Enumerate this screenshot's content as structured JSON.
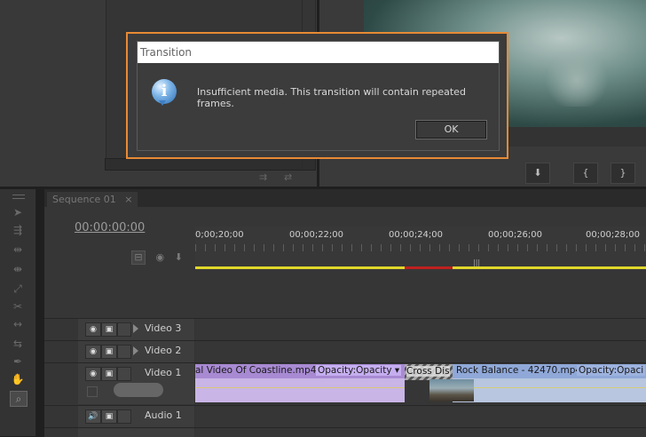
{
  "dialog": {
    "title": "Transition",
    "message": "Insufficient media. This transition will contain repeated frames.",
    "ok_label": "OK",
    "icon": "info-icon"
  },
  "sequence": {
    "tab_label": "Sequence 01",
    "timecode": "00:00:00:00",
    "ruler_labels": [
      "0;00;20;00",
      "00;00;22;00",
      "00;00;24;00",
      "00;00;26;00",
      "00;00;28;00"
    ]
  },
  "tracks": {
    "video3": "Video 3",
    "video2": "Video 2",
    "video1": "Video 1",
    "audio1": "Audio 1"
  },
  "clips": {
    "clip1_name": "al Video Of Coastline.mp4",
    "clip1_opacity": "Opacity:Opacity",
    "transition": "Cross Dis",
    "clip2_name": "Rock Balance - 42470.mp4",
    "clip2_opacity": "Opacity:Opaci"
  },
  "colors": {
    "dialog_border": "#e88a35",
    "clip_purple": "#a88ad3",
    "clip_blue": "#8fa8d8",
    "work_area": "#e1d82a"
  }
}
